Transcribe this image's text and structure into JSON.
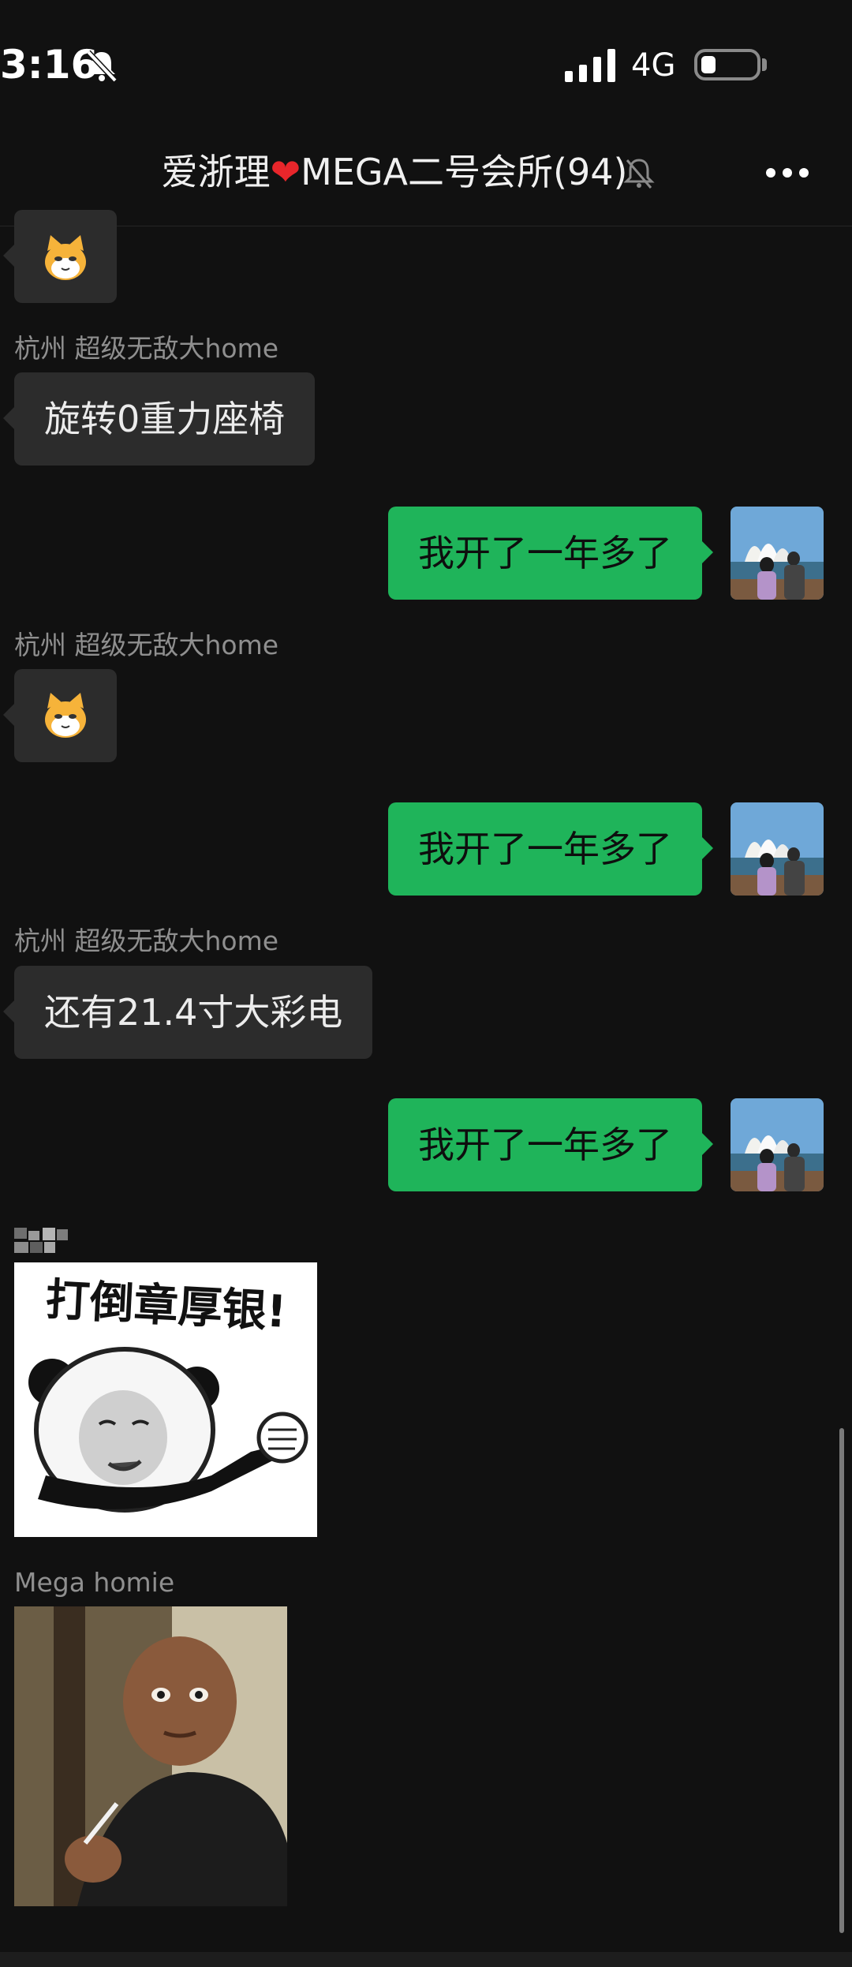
{
  "status_bar": {
    "time": "3:16",
    "network": "4G",
    "icons": [
      "bell-slash-icon",
      "signal-icon",
      "battery-icon"
    ]
  },
  "header": {
    "title_prefix": "爱浙理",
    "title_heart": "❤️",
    "title_suffix": "MEGA二号会所(94)",
    "icons": [
      "bell-slash-icon",
      "more-icon"
    ]
  },
  "messages": [
    {
      "side": "in",
      "type": "emoji",
      "icon": "cat-emoji-icon"
    },
    {
      "side": "in",
      "sender": "杭州 超级无敌大home",
      "text": "旋转0重力座椅"
    },
    {
      "side": "out",
      "text": "我开了一年多了"
    },
    {
      "side": "in",
      "sender": "杭州 超级无敌大home",
      "type": "emoji",
      "icon": "cat-emoji-icon"
    },
    {
      "side": "out",
      "text": "我开了一年多了"
    },
    {
      "side": "in",
      "sender": "杭州 超级无敌大home",
      "text": "还有21.4寸大彩电"
    },
    {
      "side": "out",
      "text": "我开了一年多了"
    },
    {
      "side": "in",
      "type": "sticker",
      "sticker_text": "打倒章厚银!"
    },
    {
      "side": "in",
      "sender": "Mega homie",
      "type": "sticker",
      "icon": "man-with-cigarette-meme-icon"
    }
  ],
  "colors": {
    "background": "#111111",
    "bubble_in": "#2c2c2c",
    "bubble_out": "#1fb45a",
    "heart": "#e8262b"
  }
}
